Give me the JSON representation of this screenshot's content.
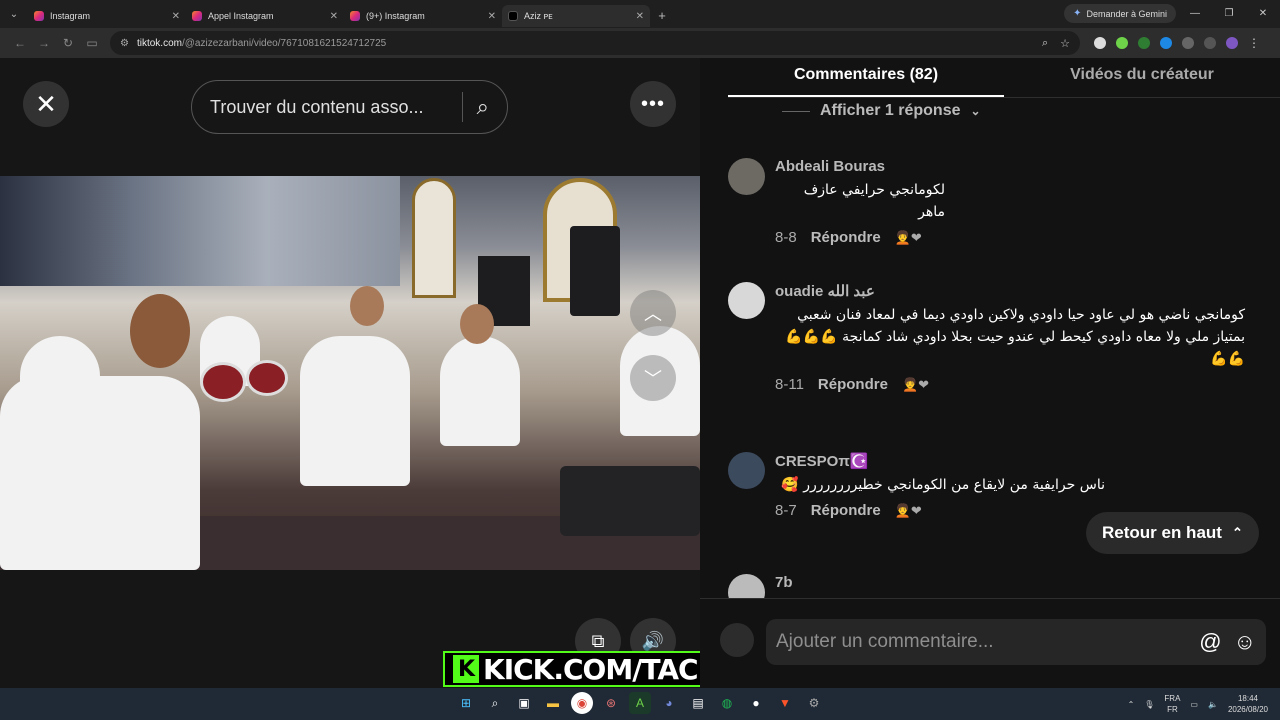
{
  "browser": {
    "tabs": [
      {
        "label": "Instagram",
        "active": false
      },
      {
        "label": "Appel Instagram",
        "active": false
      },
      {
        "label": "(9+) Instagram",
        "active": false
      },
      {
        "label": "Aziz ᴘᴇ",
        "active": true
      }
    ],
    "gemini_label": "Demander à Gemini",
    "url_host": "tiktok.com",
    "url_path": "/@azizezarbani/video/7671081621524712725"
  },
  "video_panel": {
    "search_placeholder": "Trouver du contenu asso...",
    "kick_text": "KICK.COM/TACHTOUCH"
  },
  "comments_panel": {
    "tabs": [
      {
        "label": "Commentaires (82)",
        "active": true
      },
      {
        "label": "Vidéos du créateur",
        "active": false
      }
    ],
    "show_replies": "Afficher 1 réponse",
    "comments": [
      {
        "user": "Abdeali Bouras",
        "text": "لكومانجي حرايفي عازف ماهر",
        "date": "8-8",
        "reply": "Répondre"
      },
      {
        "user": "ouadie عبد الله",
        "text": "كومانجي ناضي هو لي عاود حيا داودي ولاكين داودي ديما في لمعاد فنان شعبي بمتياز ملي ولا معاه داودي كيحط لي عندو حيت بحلا داودي شاد كمانجة 💪💪💪 💪💪",
        "date": "8-11",
        "reply": "Répondre"
      },
      {
        "user": "CRESPOπ☪️",
        "text": "ناس حرايفية من لايقاع من الكومانجي خطيرررررررر 🥰",
        "date": "8-7",
        "reply": "Répondre"
      },
      {
        "user": "7b",
        "text": "",
        "date": "",
        "reply": ""
      }
    ],
    "back_to_top": "Retour en haut",
    "add_comment_placeholder": "Ajouter un commentaire..."
  },
  "taskbar": {
    "lang_top": "FRA",
    "lang_bottom": "FR",
    "time": "18:44",
    "date": "2026/08/20"
  }
}
